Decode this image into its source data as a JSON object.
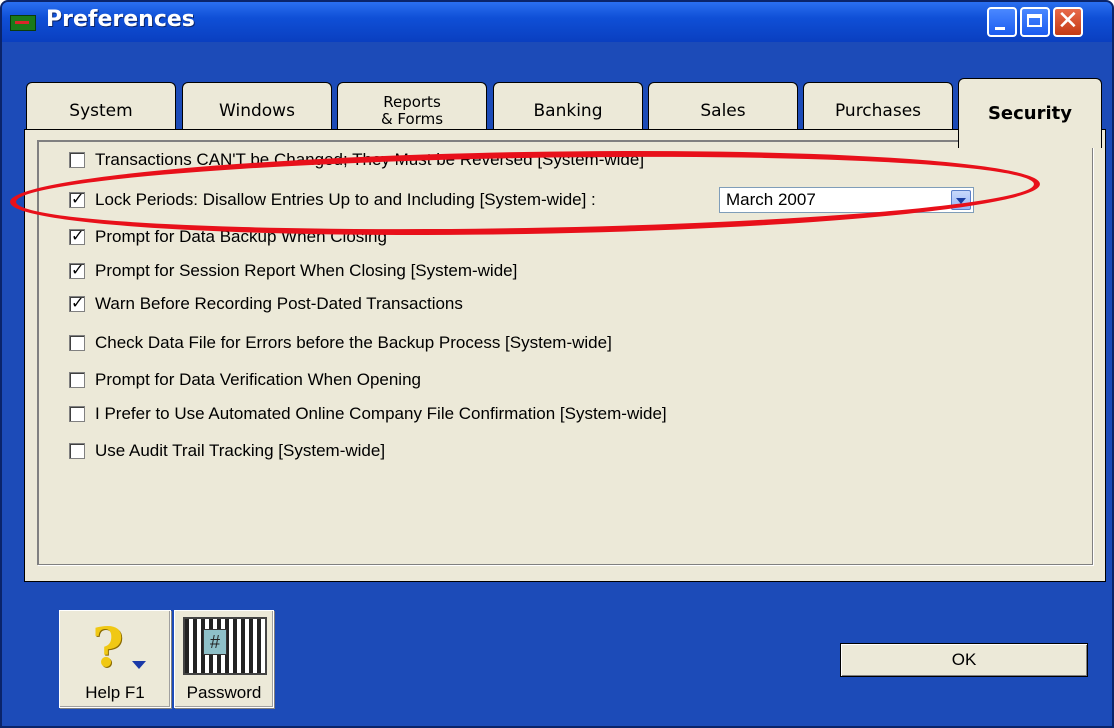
{
  "window": {
    "title": "Preferences"
  },
  "tabs": [
    {
      "label": "System"
    },
    {
      "label": "Windows"
    },
    {
      "label": "Reports\n& Forms"
    },
    {
      "label": "Banking"
    },
    {
      "label": "Sales"
    },
    {
      "label": "Purchases"
    },
    {
      "label": "Security",
      "active": true
    }
  ],
  "options": [
    {
      "label": "Transactions CAN'T be Changed; They Must be Reversed [System-wide]",
      "checked": false
    },
    {
      "label": "Lock Periods: Disallow Entries Up to and Including [System-wide] :",
      "checked": true
    },
    {
      "label": "Prompt for Data Backup When Closing",
      "checked": true
    },
    {
      "label": "Prompt for Session Report When Closing [System-wide]",
      "checked": true
    },
    {
      "label": "Warn Before Recording Post-Dated Transactions",
      "checked": true
    },
    {
      "label": "Check Data File for Errors before the Backup Process [System-wide]",
      "checked": false
    },
    {
      "label": "Prompt for Data Verification When Opening",
      "checked": false
    },
    {
      "label": "I Prefer to Use Automated Online Company File Confirmation [System-wide]",
      "checked": false
    },
    {
      "label": "Use Audit Trail Tracking [System-wide]",
      "checked": false
    }
  ],
  "lock_period": {
    "value": "March 2007"
  },
  "buttons": {
    "help": "Help F1",
    "password": "Password",
    "ok": "OK"
  },
  "colors": {
    "titlebar": "#0f4fd6",
    "panel": "#ece9d8",
    "highlight": "#e8101a",
    "frame": "#1c4bb8"
  },
  "icons": [
    "app-icon",
    "minimize-icon",
    "maximize-icon",
    "close-icon",
    "help-icon",
    "password-icon",
    "dropdown-arrow-icon"
  ]
}
